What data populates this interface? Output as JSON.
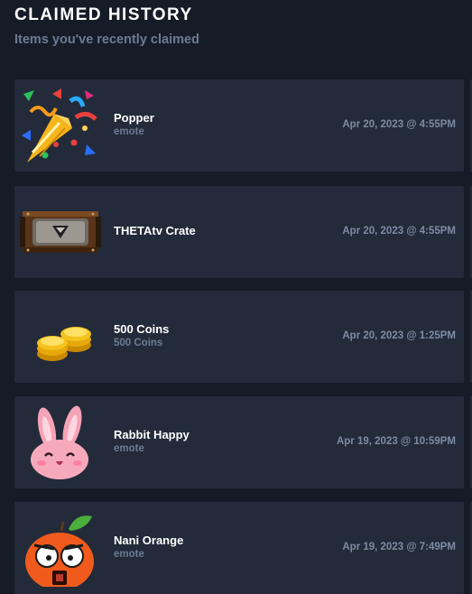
{
  "header": {
    "title": "CLAIMED HISTORY",
    "subtitle": "Items you've recently claimed"
  },
  "items": [
    {
      "name": "Popper",
      "type": "emote",
      "date": "Apr 20, 2023 @ 4:55PM",
      "icon": "popper-icon"
    },
    {
      "name": "THETAtv Crate",
      "type": "",
      "date": "Apr 20, 2023 @ 4:55PM",
      "icon": "crate-tv-icon"
    },
    {
      "name": "500 Coins",
      "type": "500 Coins",
      "date": "Apr 20, 2023 @ 1:25PM",
      "icon": "coins-icon"
    },
    {
      "name": "Rabbit Happy",
      "type": "emote",
      "date": "Apr 19, 2023 @ 10:59PM",
      "icon": "rabbit-icon"
    },
    {
      "name": "Nani Orange",
      "type": "emote",
      "date": "Apr 19, 2023 @ 7:49PM",
      "icon": "orange-icon"
    }
  ]
}
